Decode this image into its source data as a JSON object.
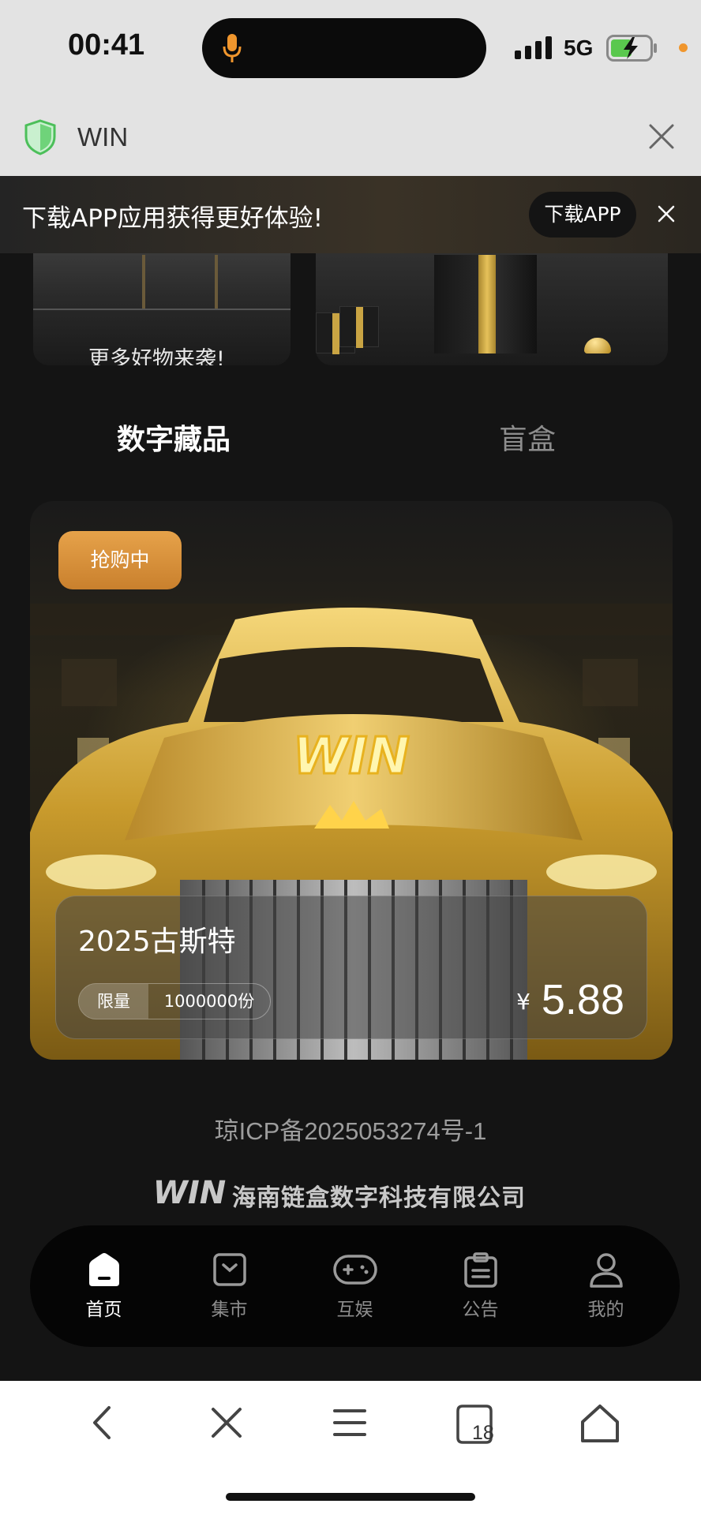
{
  "status_bar": {
    "time": "00:41",
    "network": "5G"
  },
  "browser_header": {
    "site_title": "WIN"
  },
  "download_banner": {
    "text": "下载APP应用获得更好体验!",
    "button_label": "下载APP"
  },
  "promo": {
    "left_text": "更多好物来袭!"
  },
  "tabs": [
    "数字藏品",
    "盲盒"
  ],
  "product": {
    "badge": "抢购中",
    "name": "2025古斯特",
    "limit_label": "限量",
    "limit_value": "1000000份",
    "currency": "¥",
    "price": "5.88",
    "emblem": "WIN"
  },
  "footer": {
    "icp": "琼ICP备2025053274号-1",
    "company": "海南链盒数字科技有限公司",
    "logo_text": "WIN"
  },
  "nav": [
    {
      "label": "首页",
      "icon": "home-icon",
      "active": true
    },
    {
      "label": "集市",
      "icon": "market-icon",
      "active": false
    },
    {
      "label": "互娱",
      "icon": "gamepad-icon",
      "active": false
    },
    {
      "label": "公告",
      "icon": "clipboard-icon",
      "active": false
    },
    {
      "label": "我的",
      "icon": "user-icon",
      "active": false
    }
  ],
  "browser_toolbar": {
    "tabs_count": "18"
  },
  "colors": {
    "accent_orange": "#e6a24a",
    "gold": "#e6c15a",
    "background": "#141414",
    "tab_bar": "#050505"
  }
}
